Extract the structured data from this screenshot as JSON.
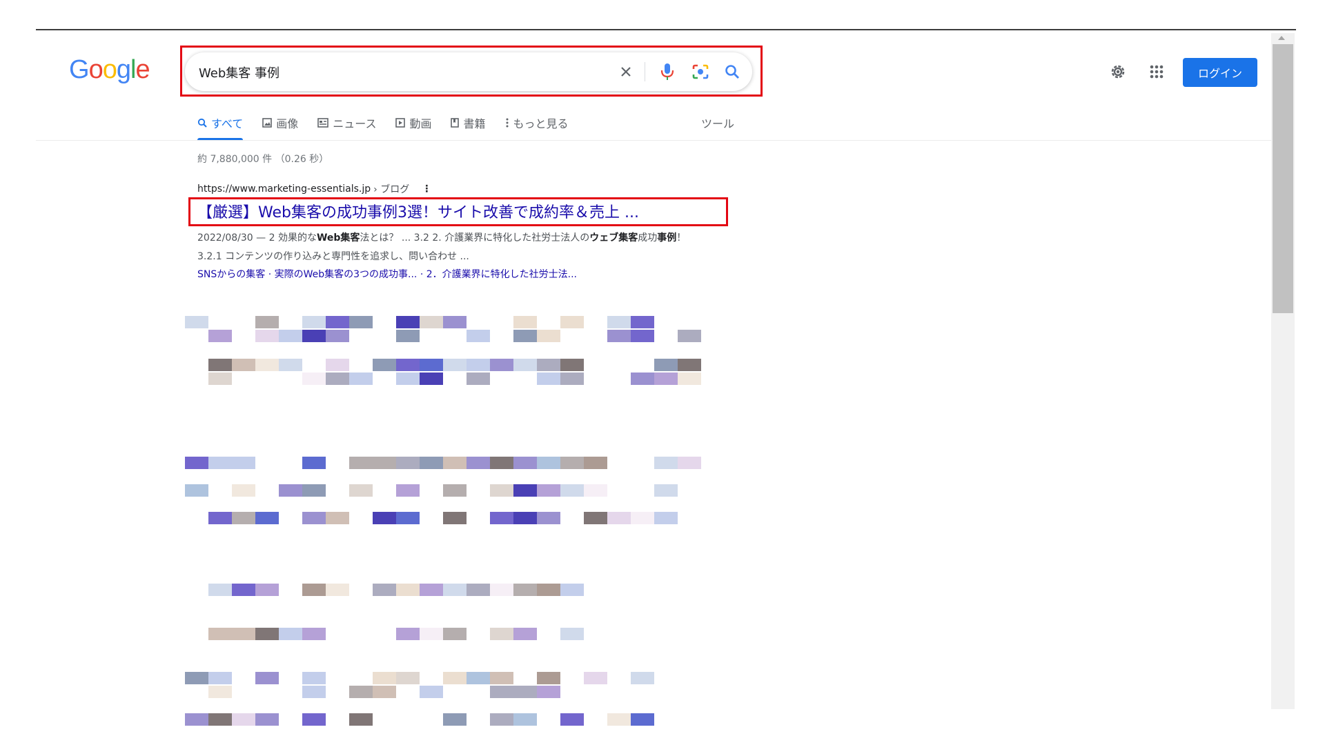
{
  "logo": {
    "letters": [
      "G",
      "o",
      "o",
      "g",
      "l",
      "e"
    ],
    "colors": [
      "#4285f4",
      "#ea4335",
      "#fbbc05",
      "#4285f4",
      "#34a853",
      "#ea4335"
    ]
  },
  "search": {
    "query": "Web集客 事例",
    "clear_icon": "close-icon",
    "voice_icon": "mic-icon",
    "lens_icon": "camera-icon",
    "search_icon": "search-icon"
  },
  "header": {
    "settings_icon": "gear-icon",
    "apps_icon": "apps-grid-icon",
    "login_label": "ログイン"
  },
  "tabs": [
    {
      "label": "すべて",
      "icon": "search-icon",
      "active": true
    },
    {
      "label": "画像",
      "icon": "image-icon"
    },
    {
      "label": "ニュース",
      "icon": "news-icon"
    },
    {
      "label": "動画",
      "icon": "play-icon"
    },
    {
      "label": "書籍",
      "icon": "book-icon"
    },
    {
      "label": "もっと見る",
      "icon": "more-vert-icon"
    }
  ],
  "tools_label": "ツール",
  "stats": "約 7,880,000 件 （0.26 秒）",
  "result": {
    "url": "https://www.marketing-essentials.jp",
    "breadcrumb": "› ブログ",
    "menu": "⋮",
    "title": "【厳選】Web集客の成功事例3選！サイト改善で成約率＆売上 ...",
    "snippet_parts": [
      {
        "text": "2022/08/30 — 2 効果的な",
        "bold": false
      },
      {
        "text": "Web集客",
        "bold": true
      },
      {
        "text": "法とは？ ... 3.2 2.  介護業界に特化した社労士法人の",
        "bold": false
      },
      {
        "text": "ウェブ集客",
        "bold": true
      },
      {
        "text": "成功",
        "bold": false
      },
      {
        "text": "事例",
        "bold": true
      },
      {
        "text": "！ 3.2.1 コンテンツの作り込みと専門性を追求し、問い合わせ ...",
        "bold": false
      }
    ],
    "sitelinks": "SNSからの集客 · 実際のWeb集客の3つの成功事... · 2．介護業界に特化した社労士法..."
  },
  "colors": {
    "accent": "#1a73e8",
    "link": "#1a0dab",
    "highlight": "#e30613"
  }
}
